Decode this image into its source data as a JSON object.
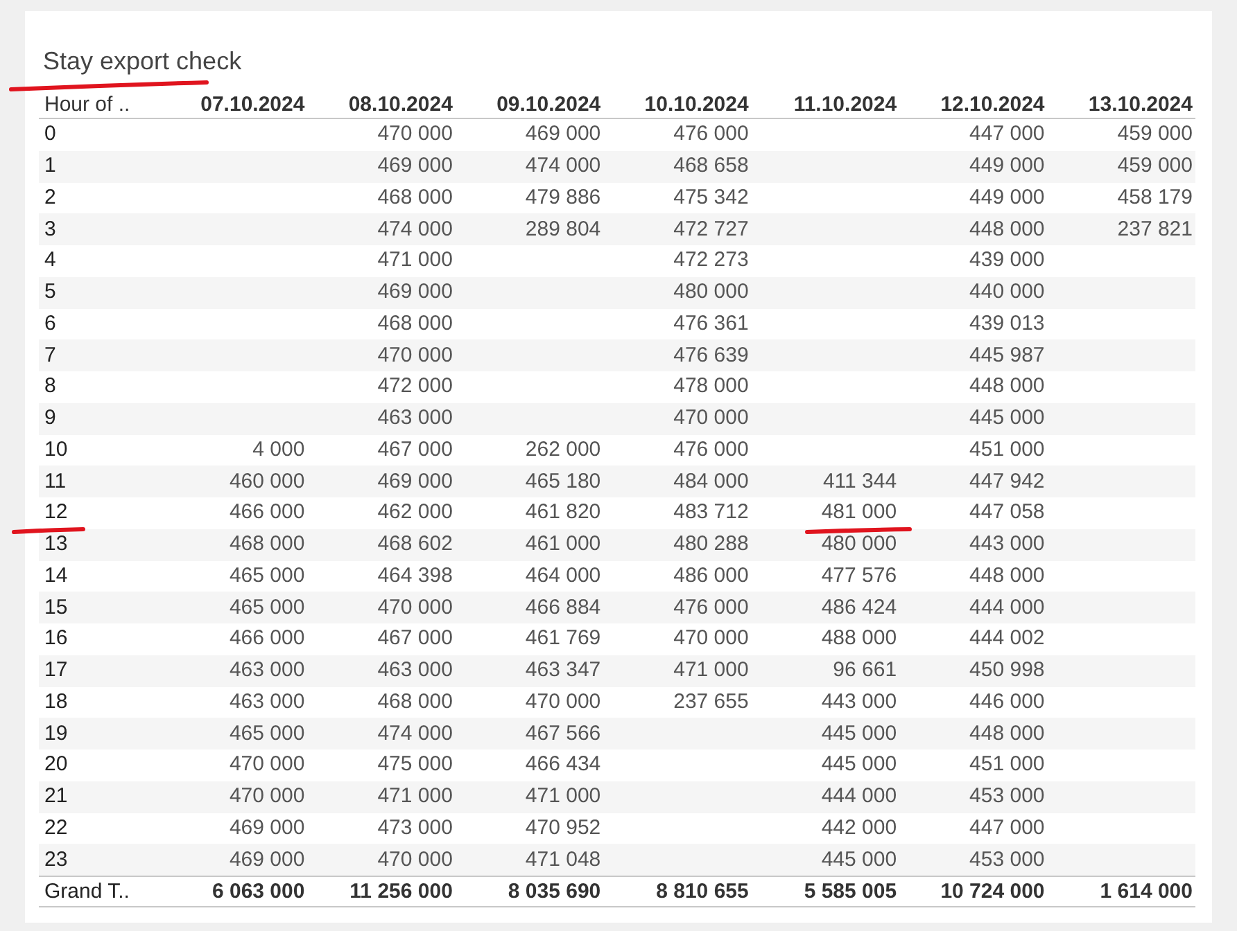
{
  "title": {
    "text": "Stay export check",
    "underlined": true
  },
  "table": {
    "columns": [
      "Hour of ..",
      "07.10.2024",
      "08.10.2024",
      "09.10.2024",
      "10.10.2024",
      "11.10.2024",
      "12.10.2024",
      "13.10.2024"
    ],
    "rows": [
      {
        "cells": [
          "0",
          "",
          "470 000",
          "469 000",
          "476 000",
          "",
          "447 000",
          "459 000"
        ],
        "underlined": [
          false,
          false,
          false,
          false,
          false,
          false,
          false,
          false
        ]
      },
      {
        "cells": [
          "1",
          "",
          "469 000",
          "474 000",
          "468 658",
          "",
          "449 000",
          "459 000"
        ],
        "underlined": [
          false,
          false,
          false,
          false,
          false,
          false,
          false,
          false
        ]
      },
      {
        "cells": [
          "2",
          "",
          "468 000",
          "479 886",
          "475 342",
          "",
          "449 000",
          "458 179"
        ],
        "underlined": [
          false,
          false,
          false,
          false,
          false,
          false,
          false,
          false
        ]
      },
      {
        "cells": [
          "3",
          "",
          "474 000",
          "289 804",
          "472 727",
          "",
          "448 000",
          "237 821"
        ],
        "underlined": [
          false,
          false,
          false,
          false,
          false,
          false,
          false,
          false
        ]
      },
      {
        "cells": [
          "4",
          "",
          "471 000",
          "",
          "472 273",
          "",
          "439 000",
          ""
        ],
        "underlined": [
          false,
          false,
          false,
          false,
          false,
          false,
          false,
          false
        ]
      },
      {
        "cells": [
          "5",
          "",
          "469 000",
          "",
          "480 000",
          "",
          "440 000",
          ""
        ],
        "underlined": [
          false,
          false,
          false,
          false,
          false,
          false,
          false,
          false
        ]
      },
      {
        "cells": [
          "6",
          "",
          "468 000",
          "",
          "476 361",
          "",
          "439 013",
          ""
        ],
        "underlined": [
          false,
          false,
          false,
          false,
          false,
          false,
          false,
          false
        ]
      },
      {
        "cells": [
          "7",
          "",
          "470 000",
          "",
          "476 639",
          "",
          "445 987",
          ""
        ],
        "underlined": [
          false,
          false,
          false,
          false,
          false,
          false,
          false,
          false
        ]
      },
      {
        "cells": [
          "8",
          "",
          "472 000",
          "",
          "478 000",
          "",
          "448 000",
          ""
        ],
        "underlined": [
          false,
          false,
          false,
          false,
          false,
          false,
          false,
          false
        ]
      },
      {
        "cells": [
          "9",
          "",
          "463 000",
          "",
          "470 000",
          "",
          "445 000",
          ""
        ],
        "underlined": [
          false,
          false,
          false,
          false,
          false,
          false,
          false,
          false
        ]
      },
      {
        "cells": [
          "10",
          "4 000",
          "467 000",
          "262 000",
          "476 000",
          "",
          "451 000",
          ""
        ],
        "underlined": [
          false,
          false,
          false,
          false,
          false,
          false,
          false,
          false
        ]
      },
      {
        "cells": [
          "11",
          "460 000",
          "469 000",
          "465 180",
          "484 000",
          "411 344",
          "447 942",
          ""
        ],
        "underlined": [
          false,
          false,
          false,
          false,
          false,
          false,
          false,
          false
        ]
      },
      {
        "cells": [
          "12",
          "466 000",
          "462 000",
          "461 820",
          "483 712",
          "481 000",
          "447 058",
          ""
        ],
        "underlined": [
          true,
          false,
          false,
          false,
          false,
          true,
          false,
          false
        ]
      },
      {
        "cells": [
          "13",
          "468 000",
          "468 602",
          "461 000",
          "480 288",
          "480 000",
          "443 000",
          ""
        ],
        "underlined": [
          false,
          false,
          false,
          false,
          false,
          false,
          false,
          false
        ]
      },
      {
        "cells": [
          "14",
          "465 000",
          "464 398",
          "464 000",
          "486 000",
          "477 576",
          "448 000",
          ""
        ],
        "underlined": [
          false,
          false,
          false,
          false,
          false,
          false,
          false,
          false
        ]
      },
      {
        "cells": [
          "15",
          "465 000",
          "470 000",
          "466 884",
          "476 000",
          "486 424",
          "444 000",
          ""
        ],
        "underlined": [
          false,
          false,
          false,
          false,
          false,
          false,
          false,
          false
        ]
      },
      {
        "cells": [
          "16",
          "466 000",
          "467 000",
          "461 769",
          "470 000",
          "488 000",
          "444 002",
          ""
        ],
        "underlined": [
          false,
          false,
          false,
          false,
          false,
          false,
          false,
          false
        ]
      },
      {
        "cells": [
          "17",
          "463 000",
          "463 000",
          "463 347",
          "471 000",
          "96 661",
          "450 998",
          ""
        ],
        "underlined": [
          false,
          false,
          false,
          false,
          false,
          false,
          false,
          false
        ]
      },
      {
        "cells": [
          "18",
          "463 000",
          "468 000",
          "470 000",
          "237 655",
          "443 000",
          "446 000",
          ""
        ],
        "underlined": [
          false,
          false,
          false,
          false,
          false,
          false,
          false,
          false
        ]
      },
      {
        "cells": [
          "19",
          "465 000",
          "474 000",
          "467 566",
          "",
          "445 000",
          "448 000",
          ""
        ],
        "underlined": [
          false,
          false,
          false,
          false,
          false,
          false,
          false,
          false
        ]
      },
      {
        "cells": [
          "20",
          "470 000",
          "475 000",
          "466 434",
          "",
          "445 000",
          "451 000",
          ""
        ],
        "underlined": [
          false,
          false,
          false,
          false,
          false,
          false,
          false,
          false
        ]
      },
      {
        "cells": [
          "21",
          "470 000",
          "471 000",
          "471 000",
          "",
          "444 000",
          "453 000",
          ""
        ],
        "underlined": [
          false,
          false,
          false,
          false,
          false,
          false,
          false,
          false
        ]
      },
      {
        "cells": [
          "22",
          "469 000",
          "473 000",
          "470 952",
          "",
          "442 000",
          "447 000",
          ""
        ],
        "underlined": [
          false,
          false,
          false,
          false,
          false,
          false,
          false,
          false
        ]
      },
      {
        "cells": [
          "23",
          "469 000",
          "470 000",
          "471 048",
          "",
          "445 000",
          "453 000",
          ""
        ],
        "underlined": [
          false,
          false,
          false,
          false,
          false,
          false,
          false,
          false
        ]
      },
      {
        "cells": [
          "Grand T..",
          "6 063 000",
          "11 256 000",
          "8 035 690",
          "8 810 655",
          "5 585 005",
          "10 724 000",
          "1 614 000"
        ],
        "underlined": [
          false,
          false,
          false,
          false,
          false,
          false,
          false,
          false
        ],
        "kind": "total"
      }
    ]
  }
}
